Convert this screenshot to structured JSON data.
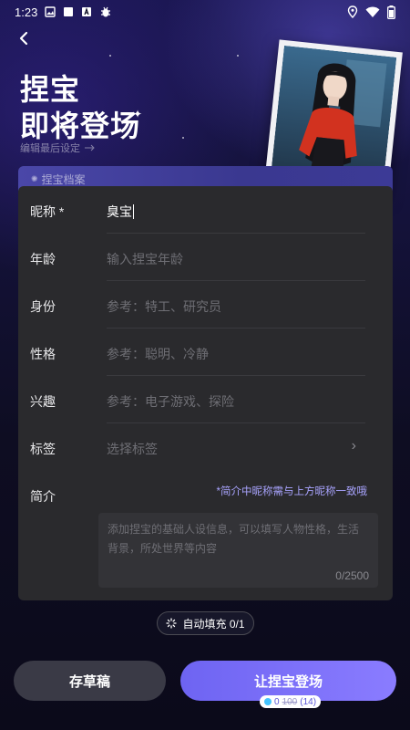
{
  "status_bar": {
    "time": "1:23",
    "icons_left": [
      "image-icon",
      "square-icon",
      "a-box-icon",
      "bug-icon"
    ],
    "icons_right": [
      "location-icon",
      "wifi-icon",
      "battery-icon"
    ]
  },
  "header": {
    "title_line1": "捏宝",
    "title_line2": "即将登场",
    "subtitle": "编辑最后设定"
  },
  "section": {
    "tab_label": "捏宝档案"
  },
  "form": {
    "fields": [
      {
        "label": "昵称 *",
        "value": "臭宝",
        "placeholder": ""
      },
      {
        "label": "年龄",
        "value": "",
        "placeholder": "输入捏宝年龄"
      },
      {
        "label": "身份",
        "value": "",
        "placeholder": "参考：特工、研究员"
      },
      {
        "label": "性格",
        "value": "",
        "placeholder": "参考：聪明、冷静"
      },
      {
        "label": "兴趣",
        "value": "",
        "placeholder": "参考：电子游戏、探险"
      },
      {
        "label": "标签",
        "value": "",
        "placeholder": "选择标签"
      }
    ],
    "bio": {
      "label": "简介",
      "hint": "*简介中昵称需与上方昵称一致哦",
      "placeholder": "添加捏宝的基础人设信息，可以填写人物性格，生活背景，所处世界等内容",
      "counter": "0/2500"
    }
  },
  "autofill": {
    "label": "自动填充 0/1"
  },
  "actions": {
    "draft_label": "存草稿",
    "submit_label": "让捏宝登场",
    "cost_new": "0",
    "cost_old": "100",
    "cost_note": "(14)"
  },
  "colors": {
    "accent": "#7b70f8",
    "panel": "#2a2a2d",
    "hint": "#a9a4ff"
  }
}
